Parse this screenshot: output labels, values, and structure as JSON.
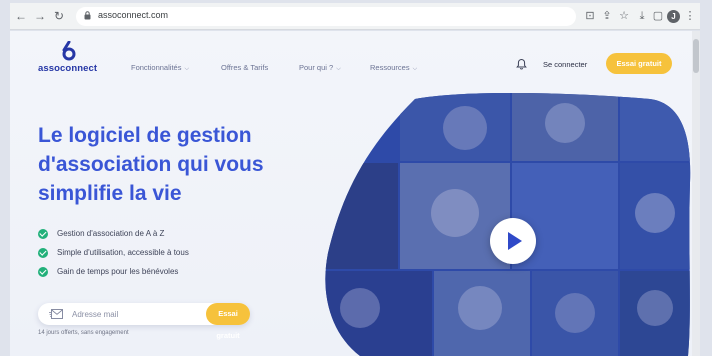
{
  "browser": {
    "url": "assoconnect.com",
    "profile_initial": "J"
  },
  "header": {
    "logo_text": "assoconnect",
    "menu": [
      {
        "label": "Fonctionnalités"
      },
      {
        "label": "Offres & Tarifs"
      },
      {
        "label": "Pour qui ?"
      },
      {
        "label": "Ressources"
      }
    ],
    "login_label": "Se connecter",
    "cta_label": "Essai gratuit"
  },
  "hero": {
    "title": "Le logiciel de gestion d'association qui vous simplifie la vie",
    "features": [
      "Gestion d'association de A à Z",
      "Simple d'utilisation, accessible à tous",
      "Gain de temps pour les bénévoles"
    ],
    "email_placeholder": "Adresse mail",
    "cta_label": "Essai gratuit",
    "trial_note": "14 jours offerts, sans engagement"
  },
  "colors": {
    "brand_blue": "#3a56d6",
    "cta_yellow": "#f6c23c",
    "check_green": "#21b07a"
  }
}
